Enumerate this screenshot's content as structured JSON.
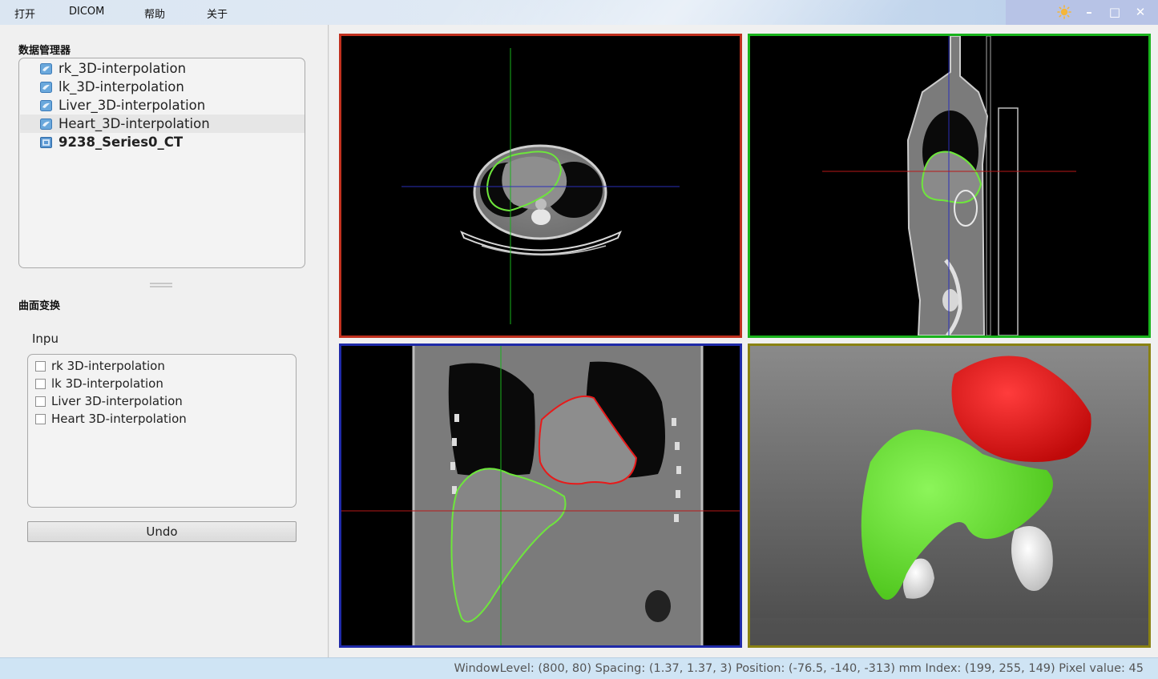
{
  "menu": {
    "open": "打开",
    "dicom": "DICOM",
    "help": "帮助",
    "about": "关于"
  },
  "window_controls": {
    "theme_icon": "sun-icon",
    "minimize": "–",
    "maximize": "□",
    "close": "✕"
  },
  "data_manager": {
    "title": "数据管理器",
    "items": [
      {
        "label": "rk_3D-interpolation",
        "icon": "surface-icon",
        "bold": false,
        "highlighted": false
      },
      {
        "label": "lk_3D-interpolation",
        "icon": "surface-icon",
        "bold": false,
        "highlighted": false
      },
      {
        "label": "Liver_3D-interpolation",
        "icon": "surface-icon",
        "bold": false,
        "highlighted": false
      },
      {
        "label": "Heart_3D-interpolation",
        "icon": "surface-icon",
        "bold": false,
        "highlighted": true
      },
      {
        "label": "9238_Series0_CT",
        "icon": "image-volume-icon",
        "bold": true,
        "highlighted": false
      }
    ]
  },
  "surface_transform": {
    "title": "曲面变换",
    "input_label": "Inpu",
    "options": [
      {
        "label": "rk  3D-interpolation",
        "checked": false
      },
      {
        "label": "lk  3D-interpolation",
        "checked": false
      },
      {
        "label": "Liver  3D-interpolation",
        "checked": false
      },
      {
        "label": "Heart  3D-interpolation",
        "checked": false
      }
    ],
    "undo_label": "Undo"
  },
  "viewports": {
    "axial_border": "#c0301e",
    "sagittal_border": "#19b31c",
    "coronal_border": "#1f2aa8",
    "render3d_border": "#8a8212",
    "liver_color": "#6ee63c",
    "heart_color": "#e81a1a",
    "kidney_color": "#eeeeee"
  },
  "status": {
    "text": "WindowLevel: (800, 80)   Spacing: (1.37, 1.37, 3)   Position: (-76.5, -140, -313) mm   Index: (199, 255, 149)   Pixel value: 45"
  }
}
